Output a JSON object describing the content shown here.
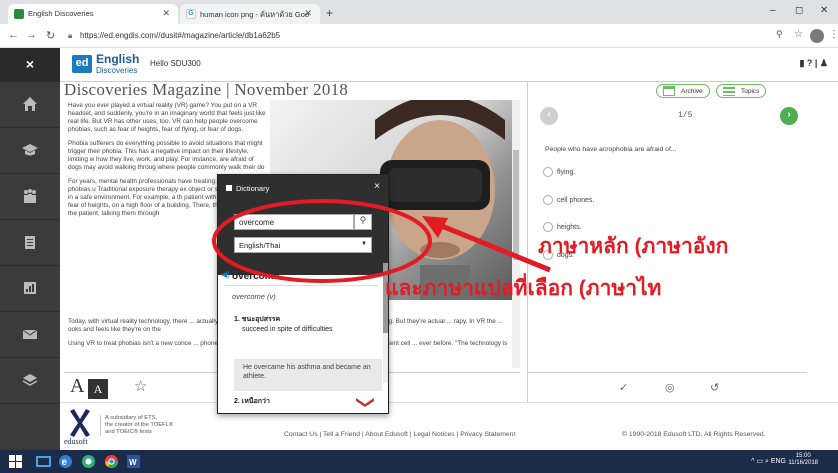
{
  "browser": {
    "tabs": [
      {
        "label": "English Discoveries",
        "active": true,
        "favicon_color": "#2b8a3e"
      },
      {
        "label": "human icon png - ค้นหาด้วย Goo",
        "active": false,
        "favicon_color": "#4285f4"
      }
    ],
    "new_tab": "+",
    "window_controls": [
      "–",
      "◻",
      "✕"
    ],
    "url": "https://ed.engdis.com//dusit#/magazine/article/db1a62b5"
  },
  "app": {
    "close_label": "×",
    "logo_abbr": "ed",
    "logo_line1": "English",
    "logo_line2": "Discoveries",
    "greeting": "Hello SDU300",
    "header_right": "▮  ? | ♟",
    "magazine_title": "Discoveries Magazine  |  November 2018"
  },
  "sidebar": {
    "items": [
      {
        "name": "home-icon"
      },
      {
        "name": "graduation-cap-icon"
      },
      {
        "name": "community-icon"
      },
      {
        "name": "assignments-icon"
      },
      {
        "name": "progress-icon"
      },
      {
        "name": "inbox-icon"
      },
      {
        "name": "book-icon"
      }
    ]
  },
  "article": {
    "paragraphs": [
      "Have you ever played a virtual reality (VR) game? You put on a VR headset, and suddenly, you're in an imaginary world that feels just like real life. But VR has other uses, too. VR can help people overcome phobias, such as fear of heights, fear of flying, or fear of dogs.",
      "Phobia sufferers do everything possible to avoid situations that might trigger their phobia. This has a negative impact on their lifestyle, limiting w how they live, work, and play. For instance, are afraid of dogs may avoid walking throug where people commonly walk their do",
      "For years, mental health professionals have treating people with phobias u Traditional exposure therapy ex object or situation they fear, in a safe environment. For example, a th patient with acrophobia, a fear of heights, on a high floor of a building. There, the the supports the patient, talking them through"
    ],
    "paragraphs_bottom": [
      "Today, with virtual reality technology, there ... actually going to the balcony of a building, ... balcony of a tall building. But they're actual ...    rapy. In VR the ... ooks and feels like they're on the",
      "Using VR to treat phobias isn't a new conce ... phone and video gaming technology has ma ...    ut 20 years. But recent cell ... ever before. \"The technology is"
    ]
  },
  "fontbar": {
    "large_a": "A",
    "small_a": "A",
    "star": "☆"
  },
  "quiz": {
    "archive_label": "Archive",
    "topics_label": "Topics",
    "prev": "‹",
    "next": "›",
    "counter": "1/5",
    "question": "People who have acrophobia are afraid of...",
    "options": [
      "flying.",
      "cell phones.",
      "heights.",
      "dogs."
    ],
    "bottom_icons": [
      "✓",
      "◎",
      "↺"
    ],
    "accent_color": "#6cbf5f"
  },
  "dictionary": {
    "title": "Dictionary",
    "close": "×",
    "search_value": "overcome",
    "search_icon": "⚲",
    "language": "English/Thai",
    "headword": "overcome",
    "pos": "overcome (v)",
    "sense1_num": "1.",
    "sense1_thai": "ชนะอุปสรรค",
    "sense1_def": "succeed in spite of difficulties",
    "example": "He overcame his asthma and became an athlete.",
    "sense2_num": "2.",
    "sense2_thai": "เหนือกว่า"
  },
  "footer": {
    "logo_text": "edusoft",
    "subsidiary": [
      "A subsidiary of ETS,",
      "the creator of the TOEFL®",
      "and TOEIC® tests"
    ],
    "links": "Contact Us | Tell a Friend | About Edusoft | Legal Notices | Privacy Statement",
    "copyright": "© 1990-2018 Edusoft LTD. All Rights Reserved."
  },
  "annotation": {
    "line1": "ภาษาหลัก (ภาษาอังก",
    "line2": "และภาษาแปลที่เลือก (ภาษาไท",
    "color": "#e31b23"
  },
  "taskbar": {
    "tray": "^ ▭ ⌕ ENG",
    "time": "15:00",
    "date": "11/16/2018"
  }
}
